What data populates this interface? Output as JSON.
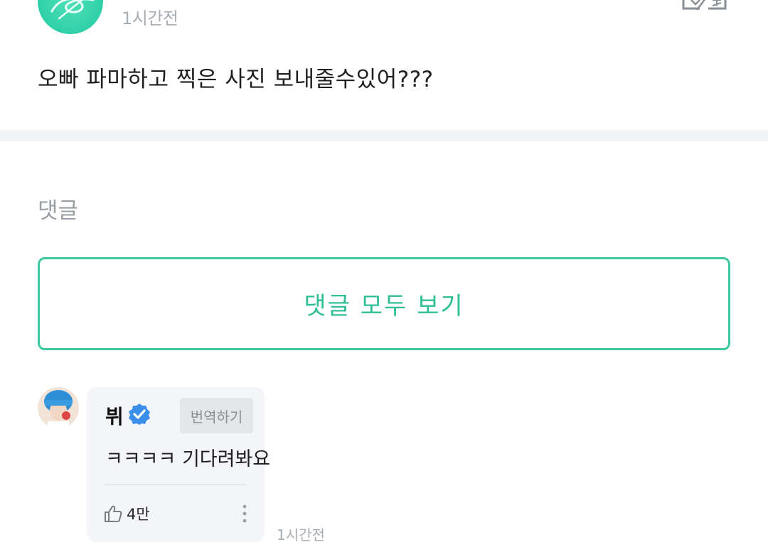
{
  "post": {
    "time": "1시간전",
    "text": "오빠 파마하고 찍은 사진 보내줄수있어???"
  },
  "comments_section": {
    "heading": "댓글",
    "view_all_label": "댓글 모두 보기"
  },
  "comment": {
    "author": "뷔",
    "translate_label": "번역하기",
    "text": "ㅋㅋㅋㅋ 기다려봐요",
    "likes": "4만",
    "time": "1시간전"
  },
  "icons": {
    "translate": "translate-icon",
    "verified": "verified-badge-icon",
    "like": "thumbs-up-icon",
    "more": "more-vertical-icon"
  },
  "colors": {
    "accent": "#3cc9a0",
    "accent_text": "#2fbf94",
    "verified": "#3b8eea",
    "muted": "#a8adb3",
    "bubble": "#f4f5f8"
  }
}
